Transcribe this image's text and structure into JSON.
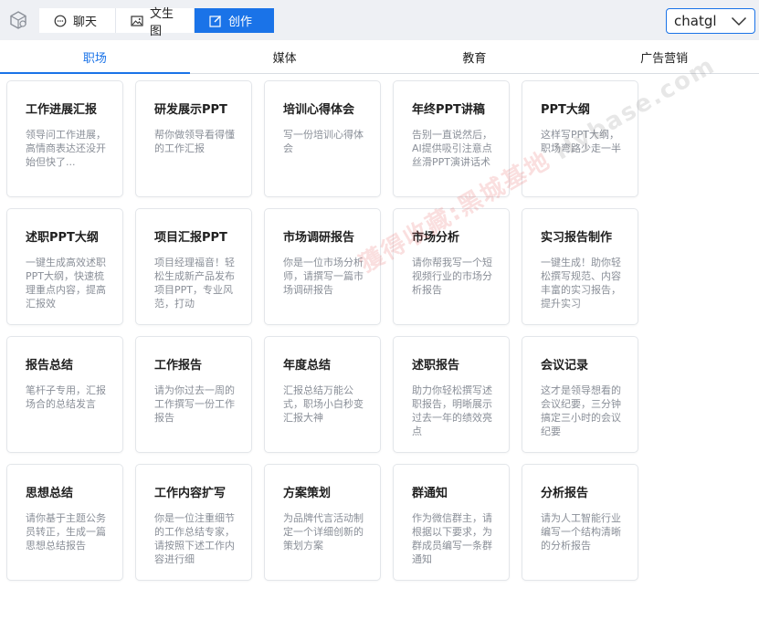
{
  "topbar": {
    "modes": [
      {
        "label": "聊天",
        "icon": "chat-icon",
        "active": false
      },
      {
        "label": "文生图",
        "icon": "image-icon",
        "active": false
      },
      {
        "label": "创作",
        "icon": "edit-icon",
        "active": true
      }
    ],
    "model_select": {
      "value": "chatgl"
    }
  },
  "tabs": [
    {
      "label": "职场",
      "active": true
    },
    {
      "label": "媒体",
      "active": false
    },
    {
      "label": "教育",
      "active": false
    },
    {
      "label": "广告营销",
      "active": false
    }
  ],
  "cards": [
    {
      "title": "工作进展汇报",
      "desc": "领导问工作进展，高情商表达还没开始但快了..."
    },
    {
      "title": "研发展示PPT",
      "desc": "帮你做领导看得懂的工作汇报"
    },
    {
      "title": "培训心得体会",
      "desc": "写一份培训心得体会"
    },
    {
      "title": "年终PPT讲稿",
      "desc": "告别一直说然后，AI提供吸引注意点丝滑PPT演讲话术"
    },
    {
      "title": "PPT大纲",
      "desc": "这样写PPT大纲，职场弯路少走一半"
    },
    {
      "title": "述职PPT大纲",
      "desc": "一键生成高效述职PPT大纲，快速梳理重点内容，提高汇报效"
    },
    {
      "title": "项目汇报PPT",
      "desc": "项目经理福音！轻松生成新产品发布项目PPT，专业风范，打动"
    },
    {
      "title": "市场调研报告",
      "desc": "你是一位市场分析师，请撰写一篇市场调研报告"
    },
    {
      "title": "市场分析",
      "desc": "请你帮我写一个短视频行业的市场分析报告"
    },
    {
      "title": "实习报告制作",
      "desc": "一键生成！助你轻松撰写规范、内容丰富的实习报告，提升实习"
    },
    {
      "title": "报告总结",
      "desc": "笔杆子专用，汇报场合的总结发言"
    },
    {
      "title": "工作报告",
      "desc": "请为你过去一周的工作撰写一份工作报告"
    },
    {
      "title": "年度总结",
      "desc": "汇报总结万能公式，职场小白秒变汇报大神"
    },
    {
      "title": "述职报告",
      "desc": "助力你轻松撰写述职报告，明晰展示过去一年的绩效亮点"
    },
    {
      "title": "会议记录",
      "desc": "这才是领导想看的会议纪要，三分钟搞定三小时的会议纪要"
    },
    {
      "title": "思想总结",
      "desc": "请你基于主题公务员转正，生成一篇思想总结报告"
    },
    {
      "title": "工作内容扩写",
      "desc": "你是一位注重细节的工作总结专家，请按照下述工作内容进行细"
    },
    {
      "title": "方案策划",
      "desc": "为品牌代言活动制定一个详细创新的策划方案"
    },
    {
      "title": "群通知",
      "desc": "作为微信群主，请根据以下要求，为群成员编写一条群通知"
    },
    {
      "title": "分析报告",
      "desc": "请为人工智能行业编写一个结构清晰的分析报告"
    }
  ],
  "watermark": {
    "cn": "獲得收藏:黑城基地",
    "en": "Hybase.com"
  },
  "colors": {
    "accent": "#1a73e8",
    "topbar_bg": "#eef0f4",
    "desc_text": "#8a8f98"
  }
}
